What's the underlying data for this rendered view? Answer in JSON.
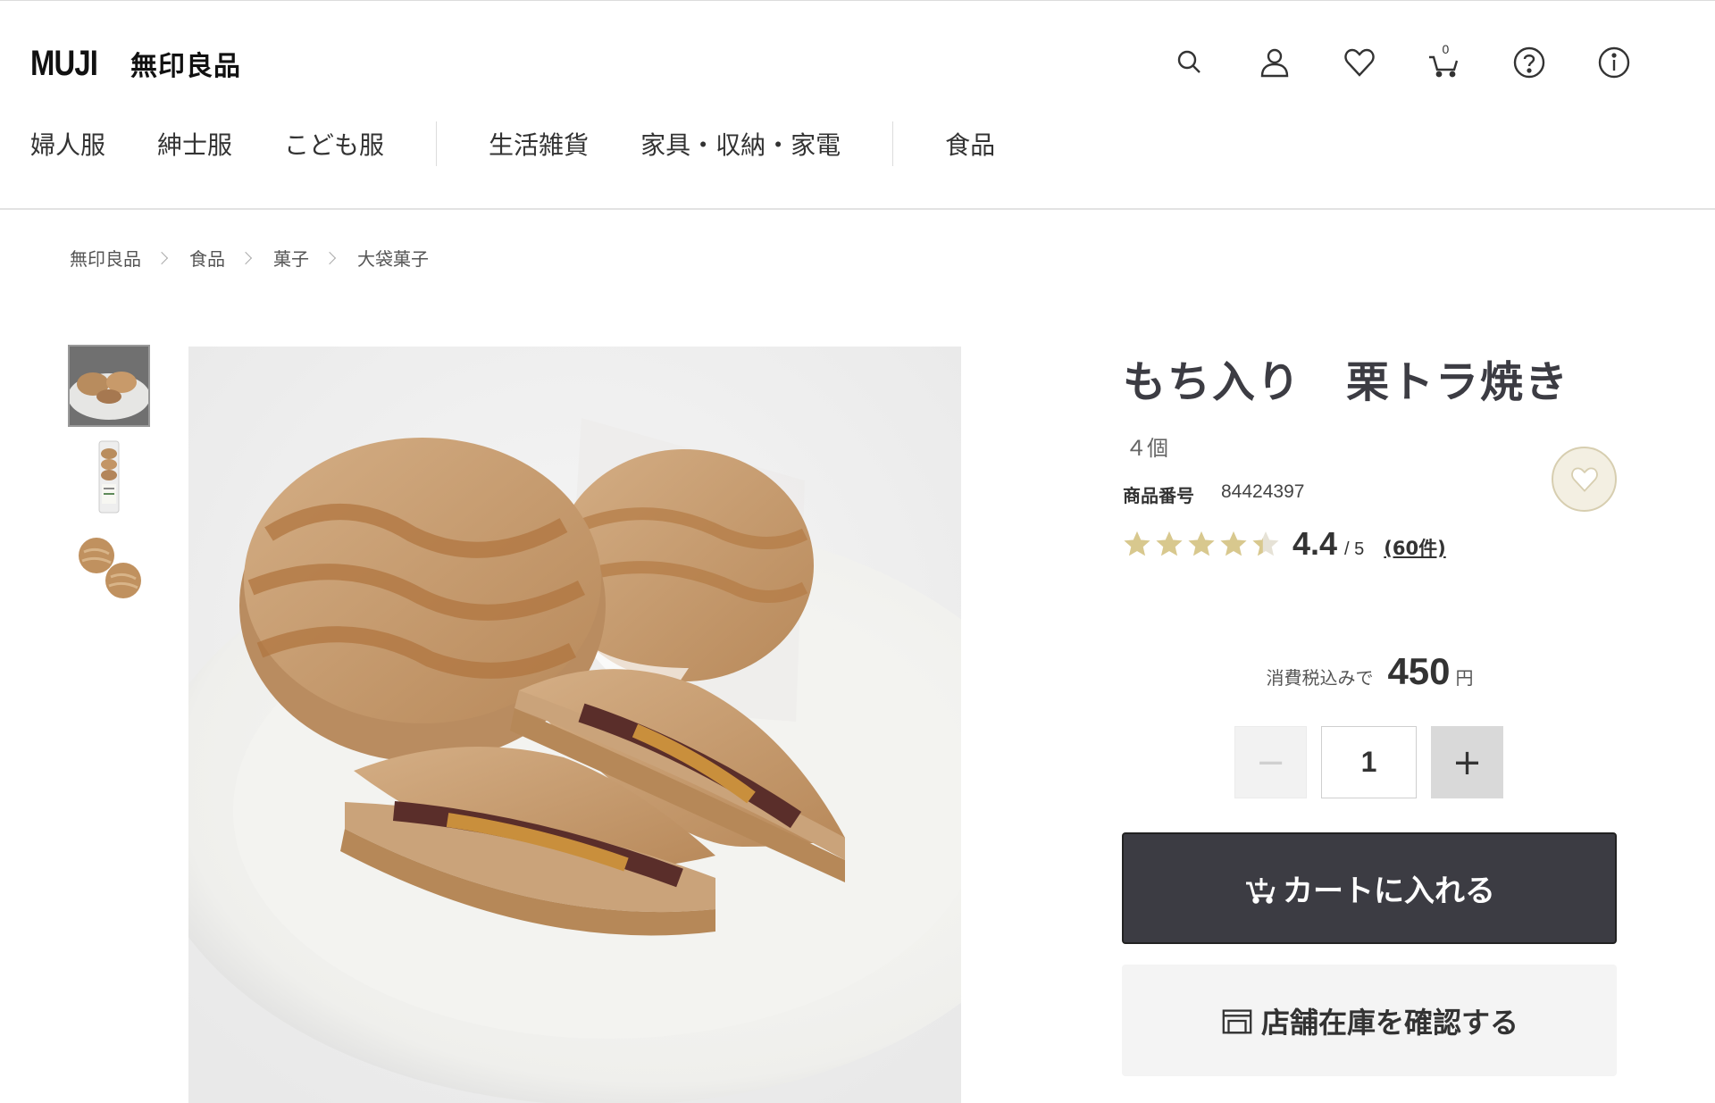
{
  "header": {
    "logo_latin": "MUJI",
    "logo_jp": "無印良品",
    "cart_count": "0",
    "icons": [
      "search-icon",
      "account-icon",
      "heart-icon",
      "cart-icon",
      "help-icon",
      "info-icon"
    ]
  },
  "nav": {
    "items": [
      "婦人服",
      "紳士服",
      "こども服",
      "生活雑貨",
      "家具・収納・家電",
      "食品"
    ]
  },
  "breadcrumb": [
    "無印良品",
    "食品",
    "菓子",
    "大袋菓子"
  ],
  "product": {
    "title": "もち入り　栗トラ焼き",
    "subtitle": "４個",
    "number_label": "商品番号",
    "number_value": "84424397",
    "rating_score": "4.4",
    "rating_max": "/ 5",
    "rating_count": "(60件)",
    "rating_value": 4.4,
    "price_label": "消費税込みで",
    "price_value": "450",
    "price_unit": "円",
    "quantity": "1",
    "qty_minus": "−",
    "qty_plus": "+",
    "cart_button": "カートに入れる",
    "store_button": "店舗在庫を確認する"
  },
  "colors": {
    "star": "#d8c88e",
    "dark_button": "#3c3c43",
    "fav_bg": "#f3efe2"
  }
}
